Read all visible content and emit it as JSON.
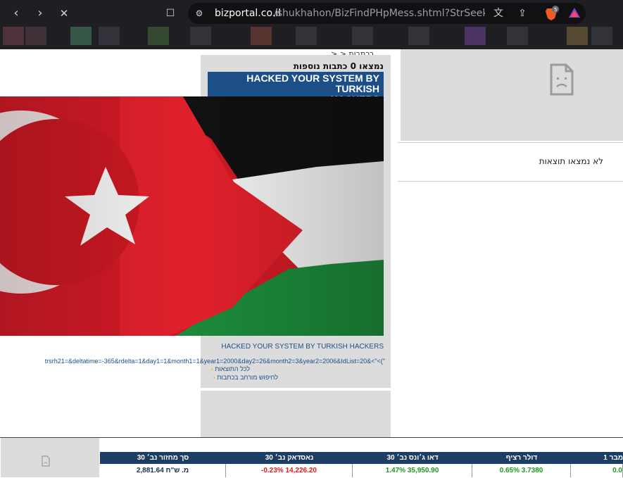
{
  "browser": {
    "url_host": "bizportal.co.il",
    "url_path": "/shukhahon/BizFindPHpMess.shtml?StrSeek=<..."
  },
  "page": {
    "breadcrumb": "בכתבות  < <",
    "count_text": "נמצאו 0 כתבות נוספות",
    "headline_line1": "HACKED YOUR SYSTEM BY TURKISH",
    "headline_line2": "HACKERS",
    "subheadline": "HACKED YOUR SYSTEM BY TURKISH HACKERS",
    "long_url": "trsrh21=&deltatime=-365&rdelta=1&day1=1&month1=1&year1=2000&day2=26&month2=3&year2=2006&IdList=20&<\"<(\"",
    "link_all_results": "לכל התוצאות",
    "link_advanced_search": "לחיפוש מורחב בכתבות",
    "no_results": "לא נמצאו תוצאות"
  },
  "ticker": {
    "headers": [
      "סך מחזור  נב׳ 30",
      "נאסדאק  נב׳ 30",
      "דאו ג׳ונס נב׳ 30",
      "דולר רציף",
      "מבר 1"
    ],
    "values": [
      {
        "text": "מ. ש\"ח 2,881.64",
        "color": "#1c2d4d"
      },
      {
        "text": "-0.23% 14,226.20",
        "color": "#e11b1b"
      },
      {
        "text": "1.47% 35,950.90",
        "color": "#1a9a1a"
      },
      {
        "text": "0.65% 3.7380",
        "color": "#1a9a1a"
      },
      {
        "text": "0.0",
        "color": "#1a9a1a"
      }
    ]
  },
  "colors": {
    "headline_bg": "#1c4f88",
    "ticker_header_bg": "#1c3d64",
    "chrome_bg": "#1f1f23"
  }
}
